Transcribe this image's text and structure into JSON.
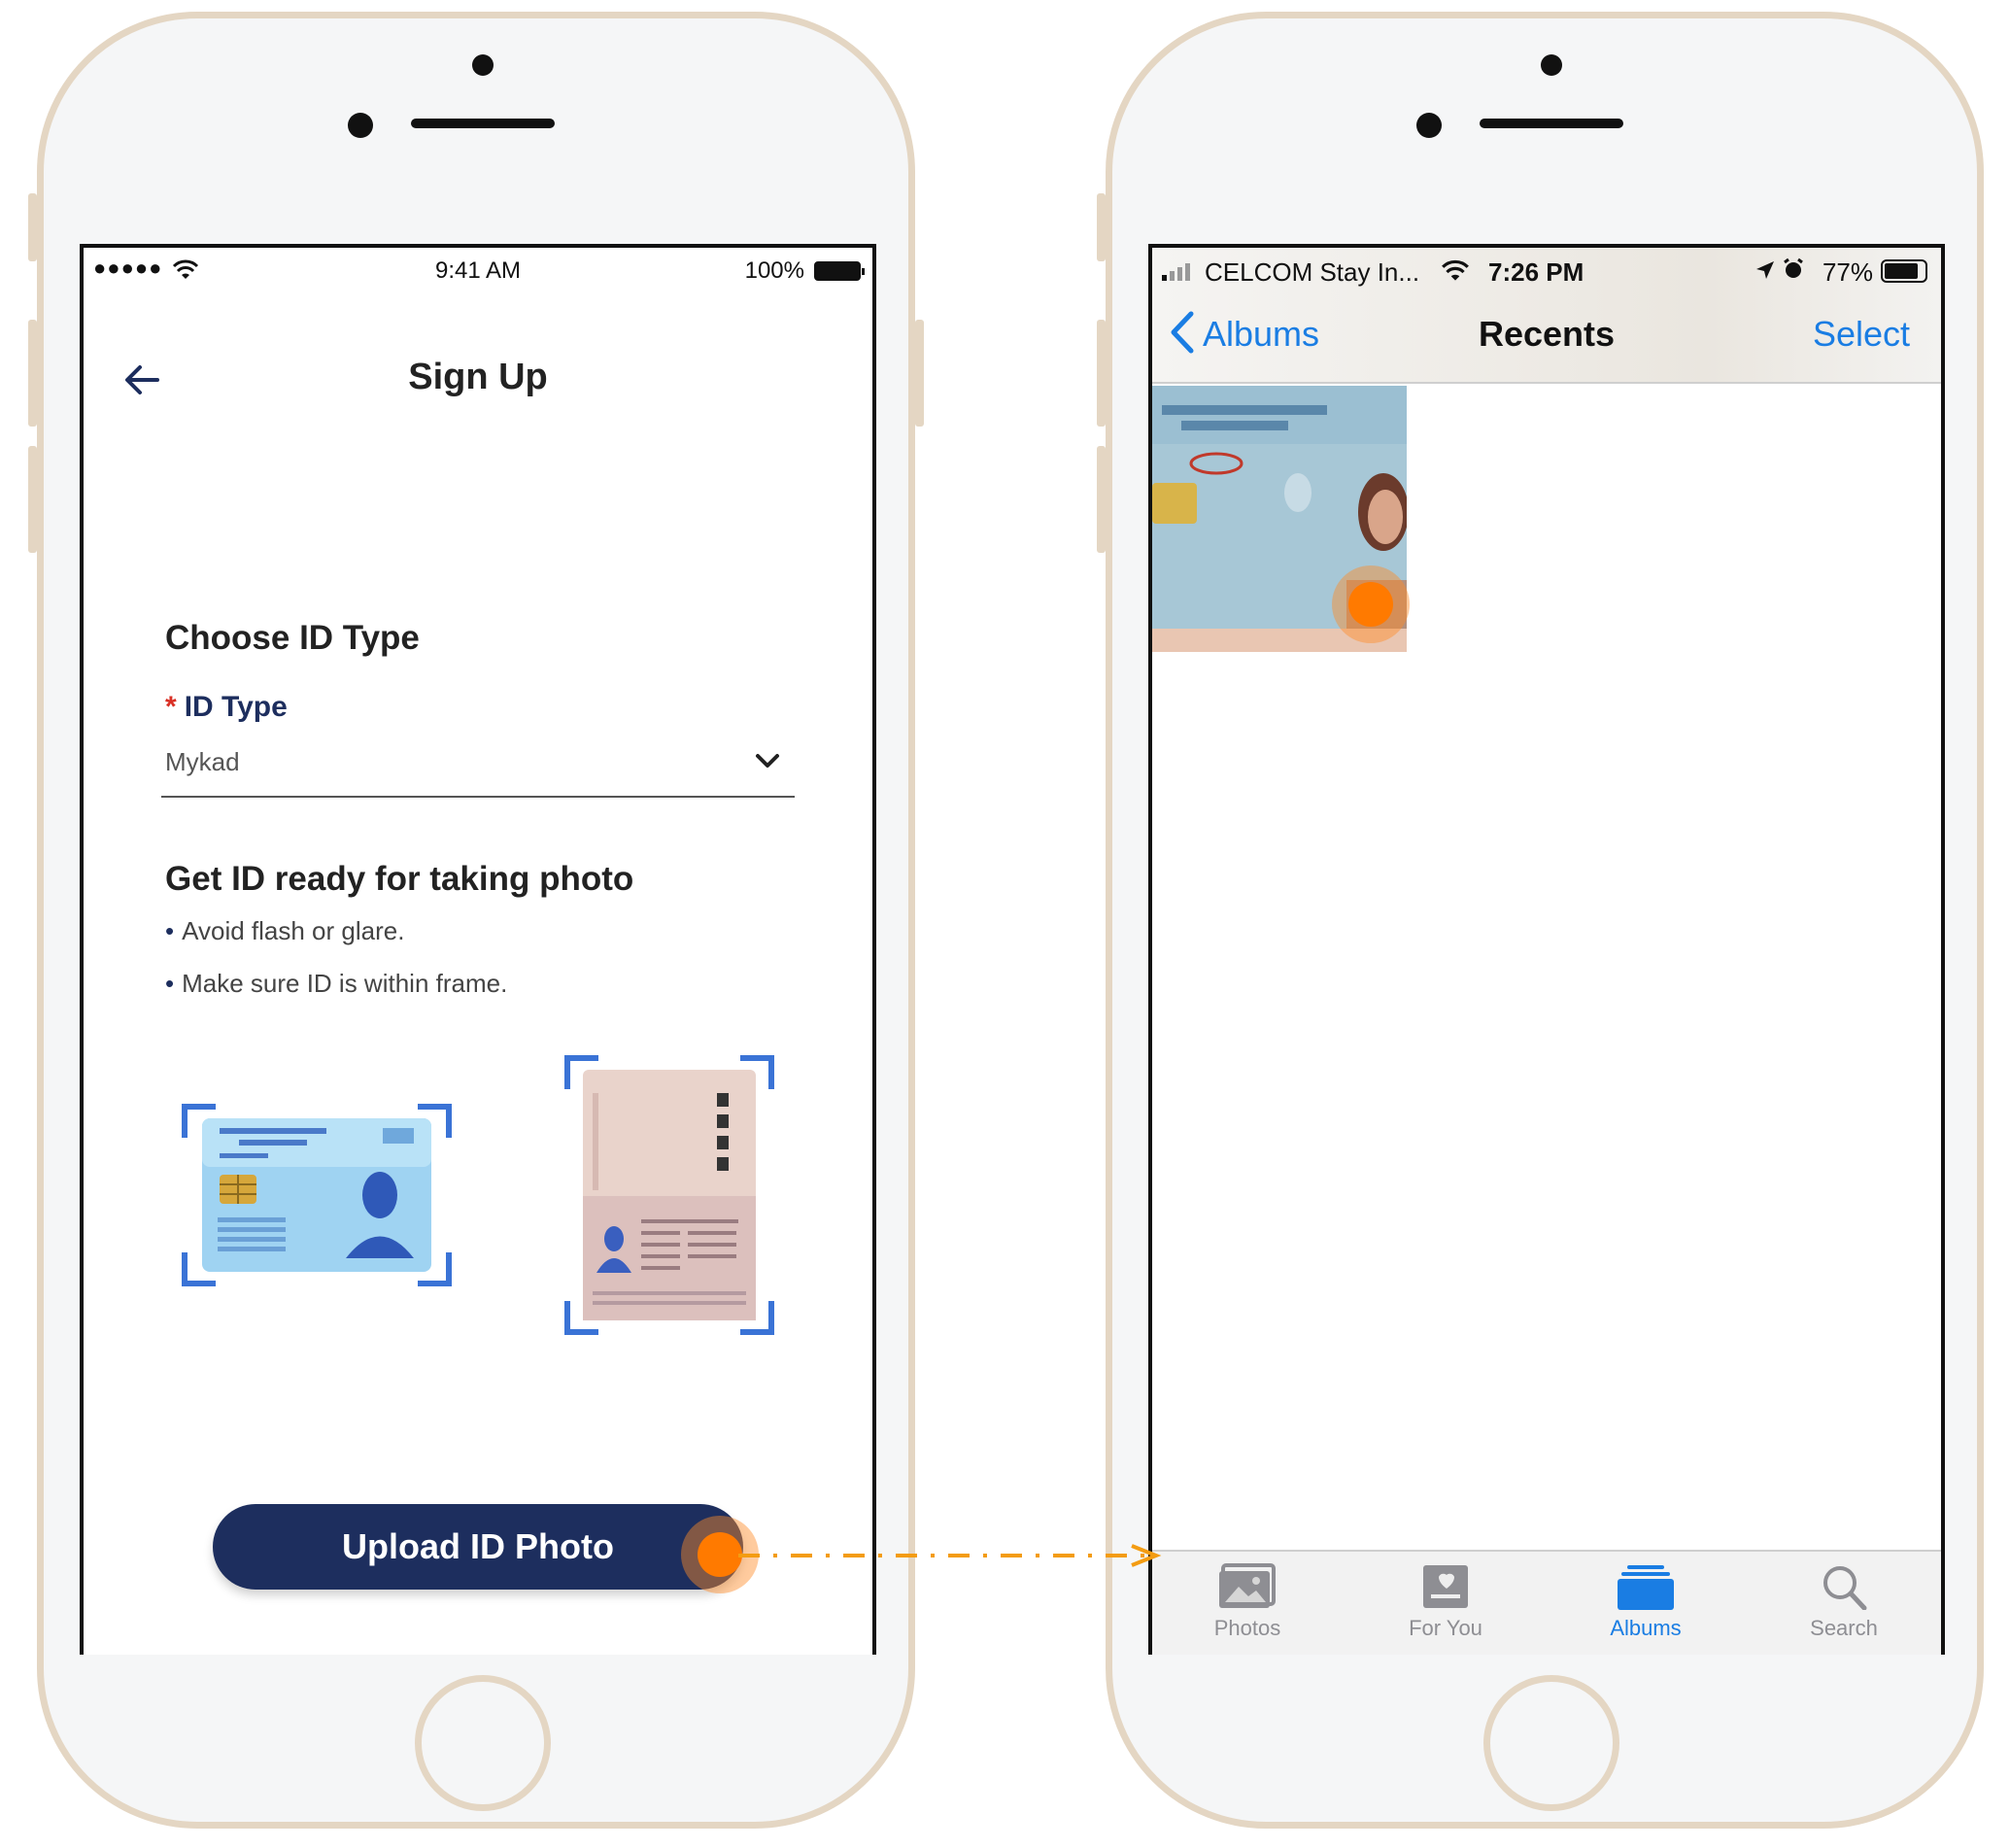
{
  "left_screen": {
    "status": {
      "signal": "●●●●●",
      "time": "9:41 AM",
      "battery": "100%"
    },
    "nav_title": "Sign Up",
    "choose_heading": "Choose ID Type",
    "id_type_label": "ID Type",
    "required_mark": "*",
    "id_type_value": "Mykad",
    "ready_heading": "Get ID ready for taking photo",
    "tips": [
      "Avoid flash or glare.",
      "Make sure ID is within frame."
    ],
    "upload_button": "Upload ID Photo"
  },
  "right_screen": {
    "status": {
      "carrier": "CELCOM Stay In...",
      "time": "7:26 PM",
      "battery": "77%"
    },
    "back_label": "Albums",
    "title": "Recents",
    "select_label": "Select",
    "tabs": [
      {
        "label": "Photos",
        "icon": "photos-icon"
      },
      {
        "label": "For You",
        "icon": "for-you-icon"
      },
      {
        "label": "Albums",
        "icon": "albums-icon"
      },
      {
        "label": "Search",
        "icon": "search-icon"
      }
    ]
  },
  "colors": {
    "brand_navy": "#1d2e5e",
    "ios_blue": "#1a7de3",
    "tap_orange": "#ff7a00",
    "phone_frame": "#e4d6c3"
  }
}
